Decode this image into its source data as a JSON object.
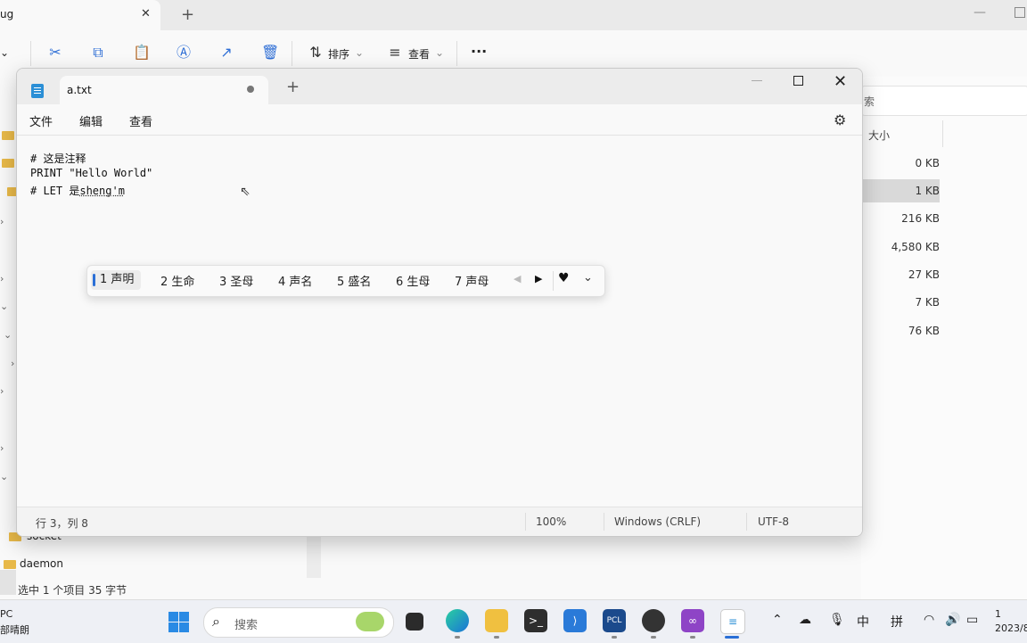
{
  "explorer": {
    "tab_label": "ug",
    "toolbar": {
      "sort_label": "排序",
      "view_label": "查看",
      "more_label": "···"
    },
    "search_placeholder": "索",
    "size_header": "大小",
    "file_sizes": [
      "0 KB",
      "1 KB",
      "216 KB",
      "4,580 KB",
      "27 KB",
      "7 KB",
      "76 KB"
    ],
    "folders": [
      "socket",
      "daemon"
    ],
    "status": "选中 1 个项目  35 字节"
  },
  "notepad": {
    "tab_title": "a.txt",
    "menu": [
      "文件",
      "编辑",
      "查看"
    ],
    "lines": [
      "# 这是注释",
      "PRINT \"Hello World\"",
      "# LET 是"
    ],
    "composing_text": "sheng'm",
    "ime_candidates": [
      "1 声明",
      "2 生命",
      "3 圣母",
      "4 声名",
      "5 盛名",
      "6 生母",
      "7 声母"
    ],
    "status": {
      "position": "行 3，列 8",
      "zoom": "100%",
      "line_ending": "Windows (CRLF)",
      "encoding": "UTF-8"
    }
  },
  "taskbar": {
    "left_top": "PC",
    "left_bottom": "部晴朗",
    "search_label": "搜索",
    "tray_lang": "中",
    "tray_ime": "拼",
    "clock_top": "1",
    "clock_bottom": "2023/8"
  }
}
